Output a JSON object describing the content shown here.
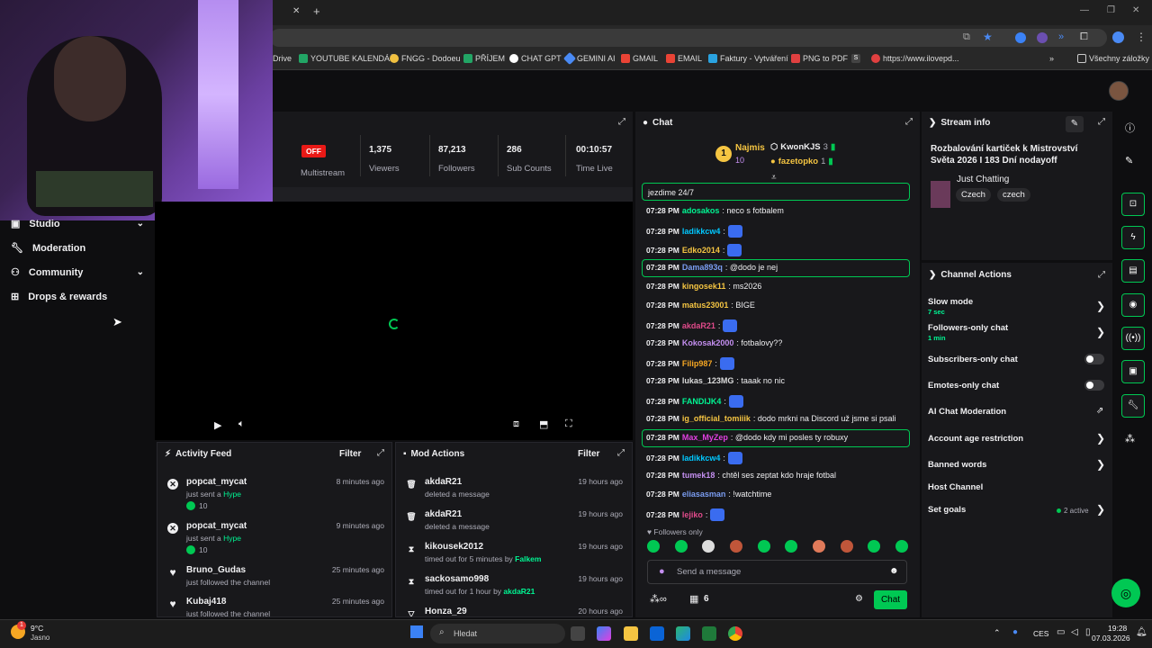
{
  "browser": {
    "bookmarks": [
      {
        "label": "Drive",
        "color": "#f5a623"
      },
      {
        "label": "YOUTUBE KALENDÁŘ",
        "color": "#22a565"
      },
      {
        "label": "FNGG - Dodoeu",
        "color": "#f0c040"
      },
      {
        "label": "PŘÍJEM",
        "color": "#22a565"
      },
      {
        "label": "CHAT GPT",
        "color": "#ffffff"
      },
      {
        "label": "GEMINI AI",
        "color": "#4a8af4"
      },
      {
        "label": "GMAIL",
        "color": "#ea4335"
      },
      {
        "label": "EMAIL",
        "color": "#ea4335"
      },
      {
        "label": "Faktury - Vytváření",
        "color": "#2aa3e0"
      },
      {
        "label": "PNG to PDF",
        "color": "#e04040"
      },
      {
        "label": "S",
        "color": "#444444"
      },
      {
        "label": "https://www.ilovepd...",
        "color": "#e04040"
      }
    ],
    "all_bookmarks": "Všechny záložky",
    "tab_close": "✕",
    "tab_new": "+"
  },
  "sidebar": {
    "items": [
      {
        "label": "Studio",
        "icon": "studio-icon",
        "chevron": true
      },
      {
        "label": "Moderation",
        "icon": "wrench-icon",
        "chevron": false
      },
      {
        "label": "Community",
        "icon": "community-icon",
        "chevron": true
      },
      {
        "label": "Drops & rewards",
        "icon": "gift-icon",
        "chevron": false
      }
    ]
  },
  "stats": {
    "status": "OFF",
    "status_label": "Multistream",
    "items": [
      {
        "value": "1,375",
        "label": "Viewers"
      },
      {
        "value": "87,213",
        "label": "Followers"
      },
      {
        "value": "286",
        "label": "Sub Counts"
      },
      {
        "value": "00:10:57",
        "label": "Time Live"
      }
    ]
  },
  "activity_feed": {
    "title": "Activity Feed",
    "filter": "Filter",
    "items": [
      {
        "name": "popcat_mycat",
        "text": "just sent a",
        "highlight": "Hype",
        "time": "8 minutes ago",
        "amount": "10",
        "icon": "hype-icon"
      },
      {
        "name": "popcat_mycat",
        "text": "just sent a",
        "highlight": "Hype",
        "time": "9 minutes ago",
        "amount": "10",
        "icon": "hype-icon"
      },
      {
        "name": "Bruno_Gudas",
        "text": "just followed the channel",
        "highlight": "",
        "time": "25 minutes ago",
        "amount": "",
        "icon": "heart-icon"
      },
      {
        "name": "Kubaj418",
        "text": "just followed the channel",
        "highlight": "",
        "time": "25 minutes ago",
        "amount": "",
        "icon": "heart-icon"
      }
    ]
  },
  "mod_actions": {
    "title": "Mod Actions",
    "filter": "Filter",
    "items": [
      {
        "name": "akdaR21",
        "text": "deleted a message",
        "by": "",
        "time": "19 hours ago",
        "icon": "trash-icon"
      },
      {
        "name": "akdaR21",
        "text": "deleted a message",
        "by": "",
        "time": "19 hours ago",
        "icon": "trash-icon"
      },
      {
        "name": "kikousek2012",
        "text": "timed out for 5 minutes by",
        "by": "Falkem",
        "time": "19 hours ago",
        "icon": "hourglass-icon"
      },
      {
        "name": "sackosamo998",
        "text": "timed out for 1 hour by",
        "by": "akdaR21",
        "time": "19 hours ago",
        "icon": "hourglass-icon"
      },
      {
        "name": "Honza_29",
        "text": "",
        "by": "",
        "time": "20 hours ago",
        "icon": "chevron-down-icon"
      }
    ]
  },
  "chat": {
    "title": "Chat",
    "leaderboard": [
      {
        "name": "Najmis",
        "rank": "1",
        "count": "10"
      },
      {
        "name": "KwonKJS",
        "rank": "2",
        "count": "3"
      },
      {
        "name": "fazetopko",
        "rank": "3",
        "count": "1"
      }
    ],
    "pinned": "jezdime 24/7",
    "messages": [
      {
        "time": "07:28 PM",
        "user": "adosakos",
        "color": "#00f593",
        "text": ": neco s fotbalem",
        "hl": false,
        "emote": false
      },
      {
        "time": "07:28 PM",
        "user": "ladikkcw4",
        "color": "#00c8ff",
        "text": ":",
        "hl": false,
        "emote": true
      },
      {
        "time": "07:28 PM",
        "user": "Edko2014",
        "color": "#f5c542",
        "text": ":",
        "hl": false,
        "emote": true
      },
      {
        "time": "07:28 PM",
        "user": "Dama893q",
        "color": "#7a9cf0",
        "text": ": @dodo je nej",
        "hl": true,
        "emote": false
      },
      {
        "time": "07:28 PM",
        "user": "kingosek11",
        "color": "#f5c542",
        "text": ": ms2026",
        "hl": false,
        "emote": false
      },
      {
        "time": "07:28 PM",
        "user": "matus23001",
        "color": "#f5c542",
        "text": ": BIGE",
        "hl": false,
        "emote": false
      },
      {
        "time": "07:28 PM",
        "user": "akdaR21",
        "color": "#e04a8a",
        "text": ":",
        "hl": false,
        "emote": true
      },
      {
        "time": "07:28 PM",
        "user": "Kokosak2000",
        "color": "#c48ff0",
        "text": ": fotbalovy??",
        "hl": false,
        "emote": false
      },
      {
        "time": "07:28 PM",
        "user": "Filip987",
        "color": "#f5a623",
        "text": ":",
        "hl": false,
        "emote": true
      },
      {
        "time": "07:28 PM",
        "user": "lukas_123MG",
        "color": "#dddddd",
        "text": ": taaak no nic",
        "hl": false,
        "emote": false
      },
      {
        "time": "07:28 PM",
        "user": "FANDIJK4",
        "color": "#00f593",
        "text": ":",
        "hl": false,
        "emote": true
      },
      {
        "time": "07:28 PM",
        "user": "ig_official_tomiiik",
        "color": "#f5c542",
        "text": ": dodo mrkni na Discord už jsme si psali",
        "hl": false,
        "emote": false
      },
      {
        "time": "07:28 PM",
        "user": "Max_MyZep",
        "color": "#e040e0",
        "text": ": @dodo kdy mi posles ty robuxy",
        "hl": true,
        "emote": false
      },
      {
        "time": "07:28 PM",
        "user": "ladikkcw4",
        "color": "#00c8ff",
        "text": ":",
        "hl": false,
        "emote": true
      },
      {
        "time": "07:28 PM",
        "user": "tumek18",
        "color": "#c48ff0",
        "text": ": chtěl ses zeptat kdo hraje fotbal",
        "hl": false,
        "emote": false
      },
      {
        "time": "07:28 PM",
        "user": "eliasasman",
        "color": "#7a9cf0",
        "text": ": !watchtime",
        "hl": false,
        "emote": false
      },
      {
        "time": "07:28 PM",
        "user": "lejiko",
        "color": "#e04a8a",
        "text": ":",
        "hl": false,
        "emote": true
      }
    ],
    "followers_only": "Followers only",
    "input_placeholder": "Send a message",
    "gift_count": "6",
    "send_label": "Chat"
  },
  "stream_info": {
    "title": "Stream info",
    "stream_title": "Rozbalování kartiček k Mistrovství Světa 2026 I 183 Dní nodayoff",
    "category": "Just Chatting",
    "tags": [
      "Czech",
      "czech"
    ]
  },
  "channel_actions": {
    "title": "Channel Actions",
    "items": [
      {
        "label": "Slow mode",
        "sub": "7 sec",
        "control": "arrow"
      },
      {
        "label": "Followers-only chat",
        "sub": "1 min",
        "control": "arrow"
      },
      {
        "label": "Subscribers-only chat",
        "sub": "",
        "control": "toggle"
      },
      {
        "label": "Emotes-only chat",
        "sub": "",
        "control": "toggle"
      },
      {
        "label": "AI Chat Moderation",
        "sub": "",
        "control": "external"
      },
      {
        "label": "Account age restriction",
        "sub": "",
        "control": "arrow"
      },
      {
        "label": "Banned words",
        "sub": "",
        "control": "arrow"
      },
      {
        "label": "Host Channel",
        "sub": "",
        "control": "none"
      },
      {
        "label": "Set goals",
        "sub": "",
        "control": "arrow",
        "status": "2 active"
      }
    ]
  },
  "taskbar": {
    "weather_temp": "9°C",
    "weather_text": "Jasno",
    "weather_badge": "1",
    "search": "Hledat",
    "lang": "CES",
    "time": "19:28",
    "date": "07.03.2026"
  },
  "colors": {
    "accent": "#00c853",
    "bg": "#0e0e10",
    "panel": "#18181b"
  }
}
